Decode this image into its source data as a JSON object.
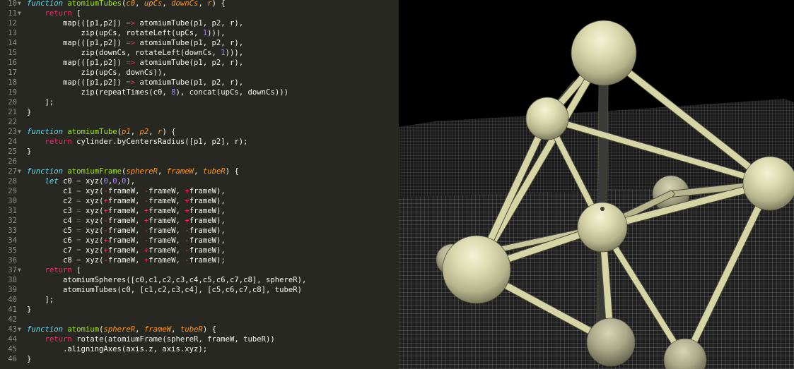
{
  "editor": {
    "lines": [
      {
        "n": "10",
        "fold": "▼",
        "tokens": [
          [
            "kw",
            "function"
          ],
          [
            "tx",
            " "
          ],
          [
            "fn",
            "atomiumTubes"
          ],
          [
            "tx",
            "("
          ],
          [
            "pm",
            "c0"
          ],
          [
            "tx",
            ", "
          ],
          [
            "pm",
            "upCs"
          ],
          [
            "tx",
            ", "
          ],
          [
            "pm",
            "downCs"
          ],
          [
            "tx",
            ", "
          ],
          [
            "pm",
            "r"
          ],
          [
            "tx",
            ") {"
          ]
        ]
      },
      {
        "n": "11",
        "fold": "▼",
        "tokens": [
          [
            "tx",
            "    "
          ],
          [
            "kr",
            "return"
          ],
          [
            "tx",
            " ["
          ]
        ]
      },
      {
        "n": "12",
        "fold": "",
        "tokens": [
          [
            "tx",
            "        map(([p1,p2]) "
          ],
          [
            "kr",
            "=>"
          ],
          [
            "tx",
            " atomiumTube(p1, p2, r),"
          ]
        ]
      },
      {
        "n": "13",
        "fold": "",
        "tokens": [
          [
            "tx",
            "            zip(upCs, rotateLeft(upCs, "
          ],
          [
            "nm",
            "1"
          ],
          [
            "tx",
            ")))"
          ],
          [
            "tx",
            ","
          ]
        ]
      },
      {
        "n": "14",
        "fold": "",
        "tokens": [
          [
            "tx",
            "        map(([p1,p2]) "
          ],
          [
            "kr",
            "=>"
          ],
          [
            "tx",
            " atomiumTube(p1, p2, r),"
          ]
        ]
      },
      {
        "n": "15",
        "fold": "",
        "tokens": [
          [
            "tx",
            "            zip(downCs, rotateLeft(downCs, "
          ],
          [
            "nm",
            "1"
          ],
          [
            "tx",
            ")))"
          ],
          [
            "tx",
            ","
          ]
        ]
      },
      {
        "n": "16",
        "fold": "",
        "tokens": [
          [
            "tx",
            "        map(([p1,p2]) "
          ],
          [
            "kr",
            "=>"
          ],
          [
            "tx",
            " atomiumTube(p1, p2, r),"
          ]
        ]
      },
      {
        "n": "17",
        "fold": "",
        "tokens": [
          [
            "tx",
            "            zip(upCs, downCs)),"
          ]
        ]
      },
      {
        "n": "18",
        "fold": "",
        "tokens": [
          [
            "tx",
            "        map(([p1,p2]) "
          ],
          [
            "kr",
            "=>"
          ],
          [
            "tx",
            " atomiumTube(p1, p2, r),"
          ]
        ]
      },
      {
        "n": "19",
        "fold": "",
        "tokens": [
          [
            "tx",
            "            zip(repeatTimes(c0, "
          ],
          [
            "nm",
            "8"
          ],
          [
            "tx",
            "), concat(upCs, downCs)))"
          ]
        ]
      },
      {
        "n": "20",
        "fold": "",
        "tokens": [
          [
            "tx",
            "    ];"
          ]
        ]
      },
      {
        "n": "21",
        "fold": "",
        "tokens": [
          [
            "tx",
            "}"
          ]
        ]
      },
      {
        "n": "22",
        "fold": "",
        "tokens": []
      },
      {
        "n": "23",
        "fold": "▼",
        "tokens": [
          [
            "kw",
            "function"
          ],
          [
            "tx",
            " "
          ],
          [
            "fn",
            "atomiumTube"
          ],
          [
            "tx",
            "("
          ],
          [
            "pm",
            "p1"
          ],
          [
            "tx",
            ", "
          ],
          [
            "pm",
            "p2"
          ],
          [
            "tx",
            ", "
          ],
          [
            "pm",
            "r"
          ],
          [
            "tx",
            ") {"
          ]
        ]
      },
      {
        "n": "24",
        "fold": "",
        "tokens": [
          [
            "tx",
            "    "
          ],
          [
            "kr",
            "return"
          ],
          [
            "tx",
            " cylinder.byCentersRadius([p1, p2], r);"
          ]
        ]
      },
      {
        "n": "25",
        "fold": "",
        "tokens": [
          [
            "tx",
            "}"
          ]
        ]
      },
      {
        "n": "26",
        "fold": "",
        "tokens": []
      },
      {
        "n": "27",
        "fold": "▼",
        "tokens": [
          [
            "kw",
            "function"
          ],
          [
            "tx",
            " "
          ],
          [
            "fn",
            "atomiumFrame"
          ],
          [
            "tx",
            "("
          ],
          [
            "pm",
            "sphereR"
          ],
          [
            "tx",
            ", "
          ],
          [
            "pm",
            "frameW"
          ],
          [
            "tx",
            ", "
          ],
          [
            "pm",
            "tubeR"
          ],
          [
            "tx",
            ") {"
          ]
        ]
      },
      {
        "n": "28",
        "fold": "",
        "tokens": [
          [
            "tx",
            "    "
          ],
          [
            "kw",
            "let"
          ],
          [
            "tx",
            " c0 "
          ],
          [
            "kr",
            "="
          ],
          [
            "tx",
            " xyz("
          ],
          [
            "nm",
            "0"
          ],
          [
            "tx",
            ","
          ],
          [
            "nm",
            "0"
          ],
          [
            "tx",
            ","
          ],
          [
            "nm",
            "0"
          ],
          [
            "tx",
            "),"
          ]
        ]
      },
      {
        "n": "29",
        "fold": "",
        "tokens": [
          [
            "tx",
            "        c1 "
          ],
          [
            "kr",
            "="
          ],
          [
            "tx",
            " xyz("
          ],
          [
            "kr",
            "-"
          ],
          [
            "tx",
            "frameW, "
          ],
          [
            "kr",
            "-"
          ],
          [
            "tx",
            "frameW, "
          ],
          [
            "kr",
            "+"
          ],
          [
            "tx",
            "frameW),"
          ]
        ]
      },
      {
        "n": "30",
        "fold": "",
        "tokens": [
          [
            "tx",
            "        c2 "
          ],
          [
            "kr",
            "="
          ],
          [
            "tx",
            " xyz("
          ],
          [
            "kr",
            "+"
          ],
          [
            "tx",
            "frameW, "
          ],
          [
            "kr",
            "-"
          ],
          [
            "tx",
            "frameW, "
          ],
          [
            "kr",
            "+"
          ],
          [
            "tx",
            "frameW),"
          ]
        ]
      },
      {
        "n": "31",
        "fold": "",
        "tokens": [
          [
            "tx",
            "        c3 "
          ],
          [
            "kr",
            "="
          ],
          [
            "tx",
            " xyz("
          ],
          [
            "kr",
            "+"
          ],
          [
            "tx",
            "frameW, "
          ],
          [
            "kr",
            "+"
          ],
          [
            "tx",
            "frameW, "
          ],
          [
            "kr",
            "+"
          ],
          [
            "tx",
            "frameW),"
          ]
        ]
      },
      {
        "n": "32",
        "fold": "",
        "tokens": [
          [
            "tx",
            "        c4 "
          ],
          [
            "kr",
            "="
          ],
          [
            "tx",
            " xyz("
          ],
          [
            "kr",
            "-"
          ],
          [
            "tx",
            "frameW, "
          ],
          [
            "kr",
            "+"
          ],
          [
            "tx",
            "frameW, "
          ],
          [
            "kr",
            "+"
          ],
          [
            "tx",
            "frameW),"
          ]
        ]
      },
      {
        "n": "33",
        "fold": "",
        "tokens": [
          [
            "tx",
            "        c5 "
          ],
          [
            "kr",
            "="
          ],
          [
            "tx",
            " xyz("
          ],
          [
            "kr",
            "-"
          ],
          [
            "tx",
            "frameW, "
          ],
          [
            "kr",
            "-"
          ],
          [
            "tx",
            "frameW, "
          ],
          [
            "kr",
            "-"
          ],
          [
            "tx",
            "frameW),"
          ]
        ]
      },
      {
        "n": "34",
        "fold": "",
        "tokens": [
          [
            "tx",
            "        c6 "
          ],
          [
            "kr",
            "="
          ],
          [
            "tx",
            " xyz("
          ],
          [
            "kr",
            "+"
          ],
          [
            "tx",
            "frameW, "
          ],
          [
            "kr",
            "-"
          ],
          [
            "tx",
            "frameW, "
          ],
          [
            "kr",
            "-"
          ],
          [
            "tx",
            "frameW),"
          ]
        ]
      },
      {
        "n": "35",
        "fold": "",
        "tokens": [
          [
            "tx",
            "        c7 "
          ],
          [
            "kr",
            "="
          ],
          [
            "tx",
            " xyz("
          ],
          [
            "kr",
            "+"
          ],
          [
            "tx",
            "frameW, "
          ],
          [
            "kr",
            "+"
          ],
          [
            "tx",
            "frameW, "
          ],
          [
            "kr",
            "-"
          ],
          [
            "tx",
            "frameW),"
          ]
        ]
      },
      {
        "n": "36",
        "fold": "",
        "tokens": [
          [
            "tx",
            "        c8 "
          ],
          [
            "kr",
            "="
          ],
          [
            "tx",
            " xyz("
          ],
          [
            "kr",
            "-"
          ],
          [
            "tx",
            "frameW, "
          ],
          [
            "kr",
            "+"
          ],
          [
            "tx",
            "frameW, "
          ],
          [
            "kr",
            "-"
          ],
          [
            "tx",
            "frameW);"
          ]
        ]
      },
      {
        "n": "37",
        "fold": "▼",
        "tokens": [
          [
            "tx",
            "    "
          ],
          [
            "kr",
            "return"
          ],
          [
            "tx",
            " ["
          ]
        ]
      },
      {
        "n": "38",
        "fold": "",
        "tokens": [
          [
            "tx",
            "        atomiumSpheres([c0,c1,c2,c3,c4,c5,c6,c7,c8], sphereR),"
          ]
        ]
      },
      {
        "n": "39",
        "fold": "",
        "tokens": [
          [
            "tx",
            "        atomiumTubes(c0, [c1,c2,c3,c4], [c5,c6,c7,c8], tubeR)"
          ]
        ]
      },
      {
        "n": "40",
        "fold": "",
        "tokens": [
          [
            "tx",
            "    ];"
          ]
        ]
      },
      {
        "n": "41",
        "fold": "",
        "tokens": [
          [
            "tx",
            "}"
          ]
        ]
      },
      {
        "n": "42",
        "fold": "",
        "tokens": []
      },
      {
        "n": "43",
        "fold": "▼",
        "tokens": [
          [
            "kw",
            "function"
          ],
          [
            "tx",
            " "
          ],
          [
            "fn",
            "atomium"
          ],
          [
            "tx",
            "("
          ],
          [
            "pm",
            "sphereR"
          ],
          [
            "tx",
            ", "
          ],
          [
            "pm",
            "frameW"
          ],
          [
            "tx",
            ", "
          ],
          [
            "pm",
            "tubeR"
          ],
          [
            "tx",
            ") {"
          ]
        ]
      },
      {
        "n": "44",
        "fold": "",
        "tokens": [
          [
            "tx",
            "    "
          ],
          [
            "kr",
            "return"
          ],
          [
            "tx",
            " rotate(atomiumFrame(sphereR, frameW, tubeR))"
          ]
        ]
      },
      {
        "n": "45",
        "fold": "",
        "tokens": [
          [
            "tx",
            "        .aligningAxes(axis.z, axis.xyz);"
          ]
        ]
      },
      {
        "n": "46",
        "fold": "",
        "tokens": [
          [
            "tx",
            "}"
          ]
        ]
      }
    ]
  },
  "colors": {
    "editor_bg": "#272822",
    "keyword": "#66d9ef",
    "operator": "#f92672",
    "function_name": "#a6e22e",
    "parameter": "#fd971f",
    "number": "#ae81ff",
    "text": "#f8f8f2",
    "line_number": "#8f908a",
    "sphere": "#d4d3a8",
    "tube": "#d6d5a6",
    "axis_tube": "#3a3b37",
    "grid": "#6e6e6e"
  },
  "viewport": {
    "scene": "atomium-3d-preview",
    "icon": "atomium-model-icon"
  }
}
